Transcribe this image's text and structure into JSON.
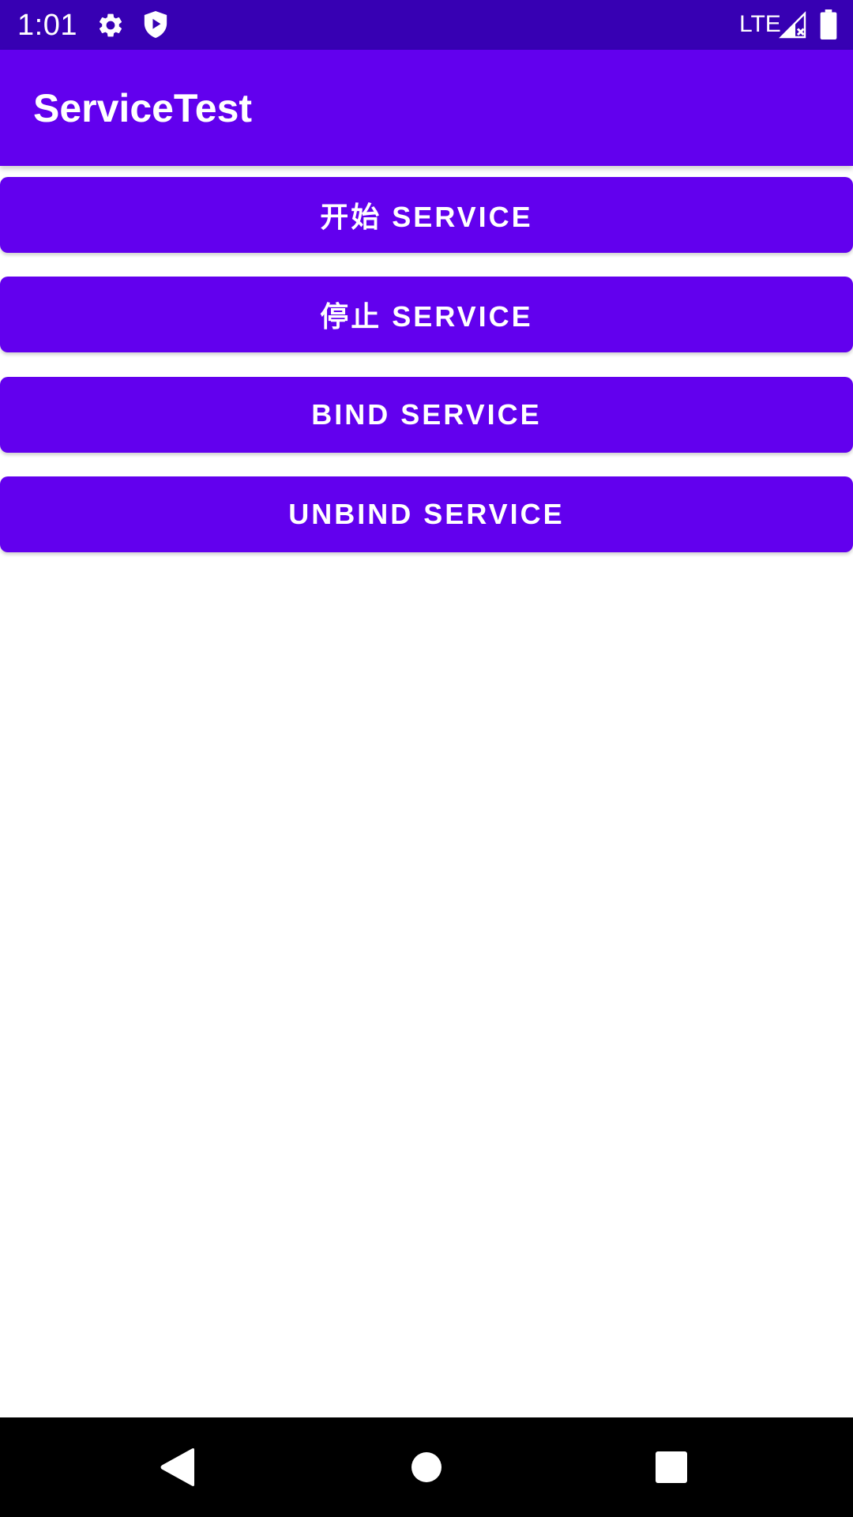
{
  "status_bar": {
    "time": "1:01",
    "network": "LTE",
    "icons": [
      "gear-icon",
      "shield-play-icon",
      "signal-icon",
      "battery-icon"
    ]
  },
  "app_bar": {
    "title": "ServiceTest"
  },
  "buttons": {
    "start_service": "开始 SERVICE",
    "stop_service": "停止 SERVICE",
    "bind_service": "BIND SERVICE",
    "unbind_service": "UNBIND SERVICE"
  },
  "nav_bar": {
    "icons": [
      "back-icon",
      "home-icon",
      "recents-icon"
    ]
  },
  "colors": {
    "status_bar": "#3700B3",
    "primary": "#6200EE",
    "nav_bar": "#000000",
    "on_primary": "#FFFFFF"
  }
}
